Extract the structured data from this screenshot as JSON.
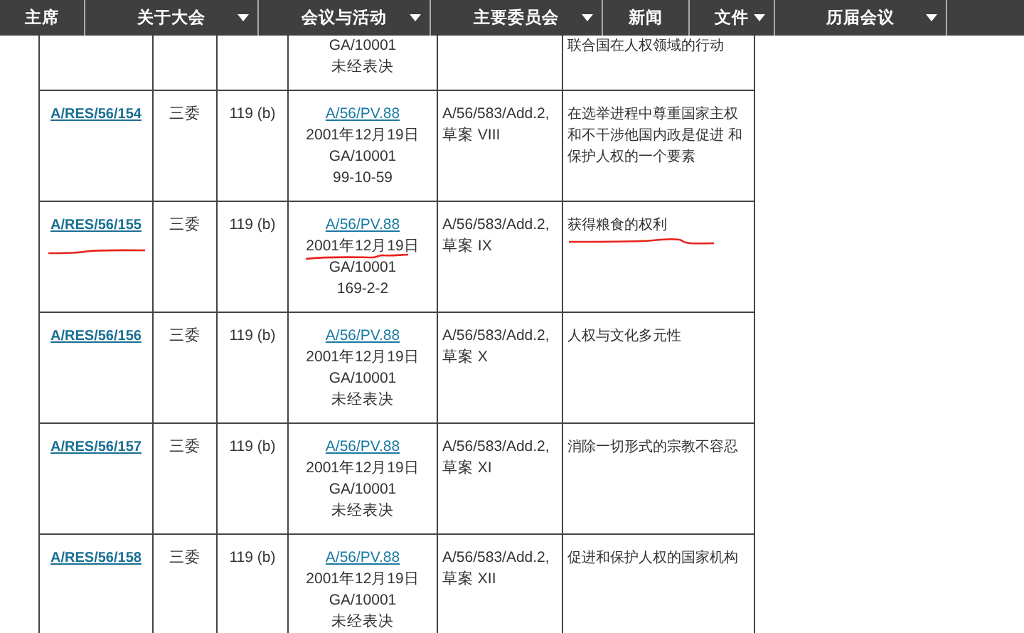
{
  "nav": [
    {
      "label": "主席",
      "dropdown": false
    },
    {
      "label": "关于大会",
      "dropdown": true
    },
    {
      "label": "会议与活动",
      "dropdown": true
    },
    {
      "label": "主要委员会",
      "dropdown": true
    },
    {
      "label": "新闻",
      "dropdown": false
    },
    {
      "label": "文件",
      "dropdown": true
    },
    {
      "label": "历届会议",
      "dropdown": true
    }
  ],
  "rows": [
    {
      "symbol": "",
      "committee": "",
      "item": "",
      "record": "",
      "date": "",
      "doc": "GA/10001",
      "vote": "未经表决",
      "report": [],
      "title": "联合国在人权领域的行动",
      "marked": false
    },
    {
      "symbol": "A/RES/56/154",
      "committee": "三委",
      "item": "119 (b)",
      "record": "A/56/PV.88",
      "date": "2001年12月19日",
      "doc": "GA/10001",
      "vote": "99-10-59",
      "report": [
        "A/56/583/Add.2,",
        "草案 VIII"
      ],
      "title": "在选举进程中尊重国家主权和不干涉他国内政是促进 和保护人权的一个要素",
      "marked": false
    },
    {
      "symbol": "A/RES/56/155",
      "committee": "三委",
      "item": "119 (b)",
      "record": "A/56/PV.88",
      "date": "2001年12月19日",
      "doc": "GA/10001",
      "vote": "169-2-2",
      "report": [
        "A/56/583/Add.2,",
        "草案 IX"
      ],
      "title": "获得粮食的权利",
      "marked": true
    },
    {
      "symbol": "A/RES/56/156",
      "committee": "三委",
      "item": "119 (b)",
      "record": "A/56/PV.88",
      "date": "2001年12月19日",
      "doc": "GA/10001",
      "vote": "未经表决",
      "report": [
        "A/56/583/Add.2,",
        "草案 X"
      ],
      "title": "人权与文化多元性",
      "marked": false
    },
    {
      "symbol": "A/RES/56/157",
      "committee": "三委",
      "item": "119 (b)",
      "record": "A/56/PV.88",
      "date": "2001年12月19日",
      "doc": "GA/10001",
      "vote": "未经表决",
      "report": [
        "A/56/583/Add.2,",
        "草案 XI"
      ],
      "title": "消除一切形式的宗教不容忍",
      "marked": false
    },
    {
      "symbol": "A/RES/56/158",
      "committee": "三委",
      "item": "119 (b)",
      "record": "A/56/PV.88",
      "date": "2001年12月19日",
      "doc": "GA/10001",
      "vote": "未经表决",
      "report": [
        "A/56/583/Add.2,",
        "草案 XII"
      ],
      "title": "促进和保护人权的国家机构",
      "marked": false
    }
  ]
}
